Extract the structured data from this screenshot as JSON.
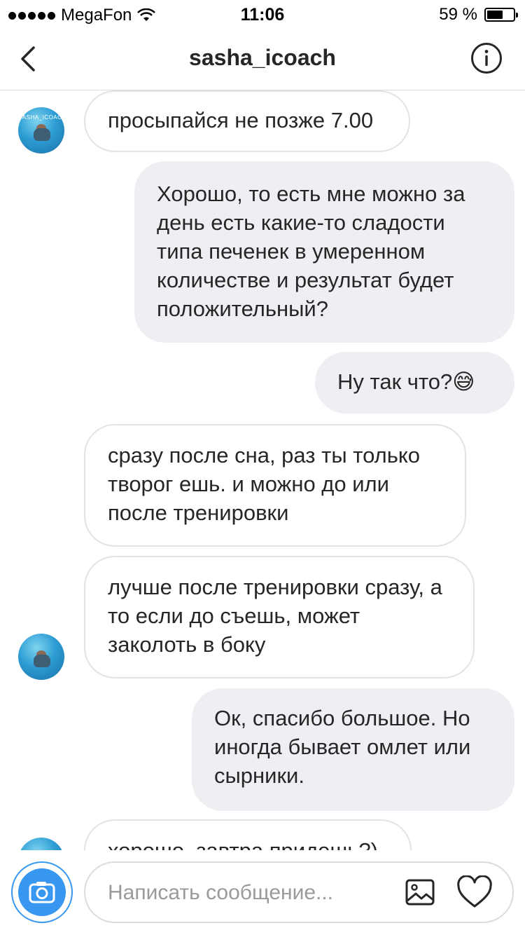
{
  "status_bar": {
    "carrier": "MegaFon",
    "time": "11:06",
    "battery": "59 %",
    "battery_level": 0.59
  },
  "header": {
    "title": "sasha_icoach"
  },
  "avatar": {
    "label": "SASHA_ICOACH"
  },
  "messages": [
    {
      "from": "them",
      "text": "просыпайся не позже 7.00"
    },
    {
      "from": "me",
      "text": "Хорошо, то есть мне можно за день есть какие-то сладости типа печенек в умеренном количестве и результат будет положительный?"
    },
    {
      "from": "me",
      "text": "Ну так что?😅"
    },
    {
      "from": "them",
      "text": "сразу после сна, раз ты только творог ешь. и можно до или после тренировки"
    },
    {
      "from": "them",
      "text": "лучше после тренировки сразу, а то если до съешь, может заколоть в боку"
    },
    {
      "from": "me",
      "text": "Ок, спасибо большое. Но иногда бывает омлет или сырники."
    },
    {
      "from": "them",
      "text": "хорошо, завтра придешь?)"
    }
  ],
  "composer": {
    "placeholder": "Написать сообщение..."
  },
  "colors": {
    "accent": "#3897f0",
    "outgoing_bubble": "#efeff3",
    "incoming_border": "#e3e3e3"
  }
}
